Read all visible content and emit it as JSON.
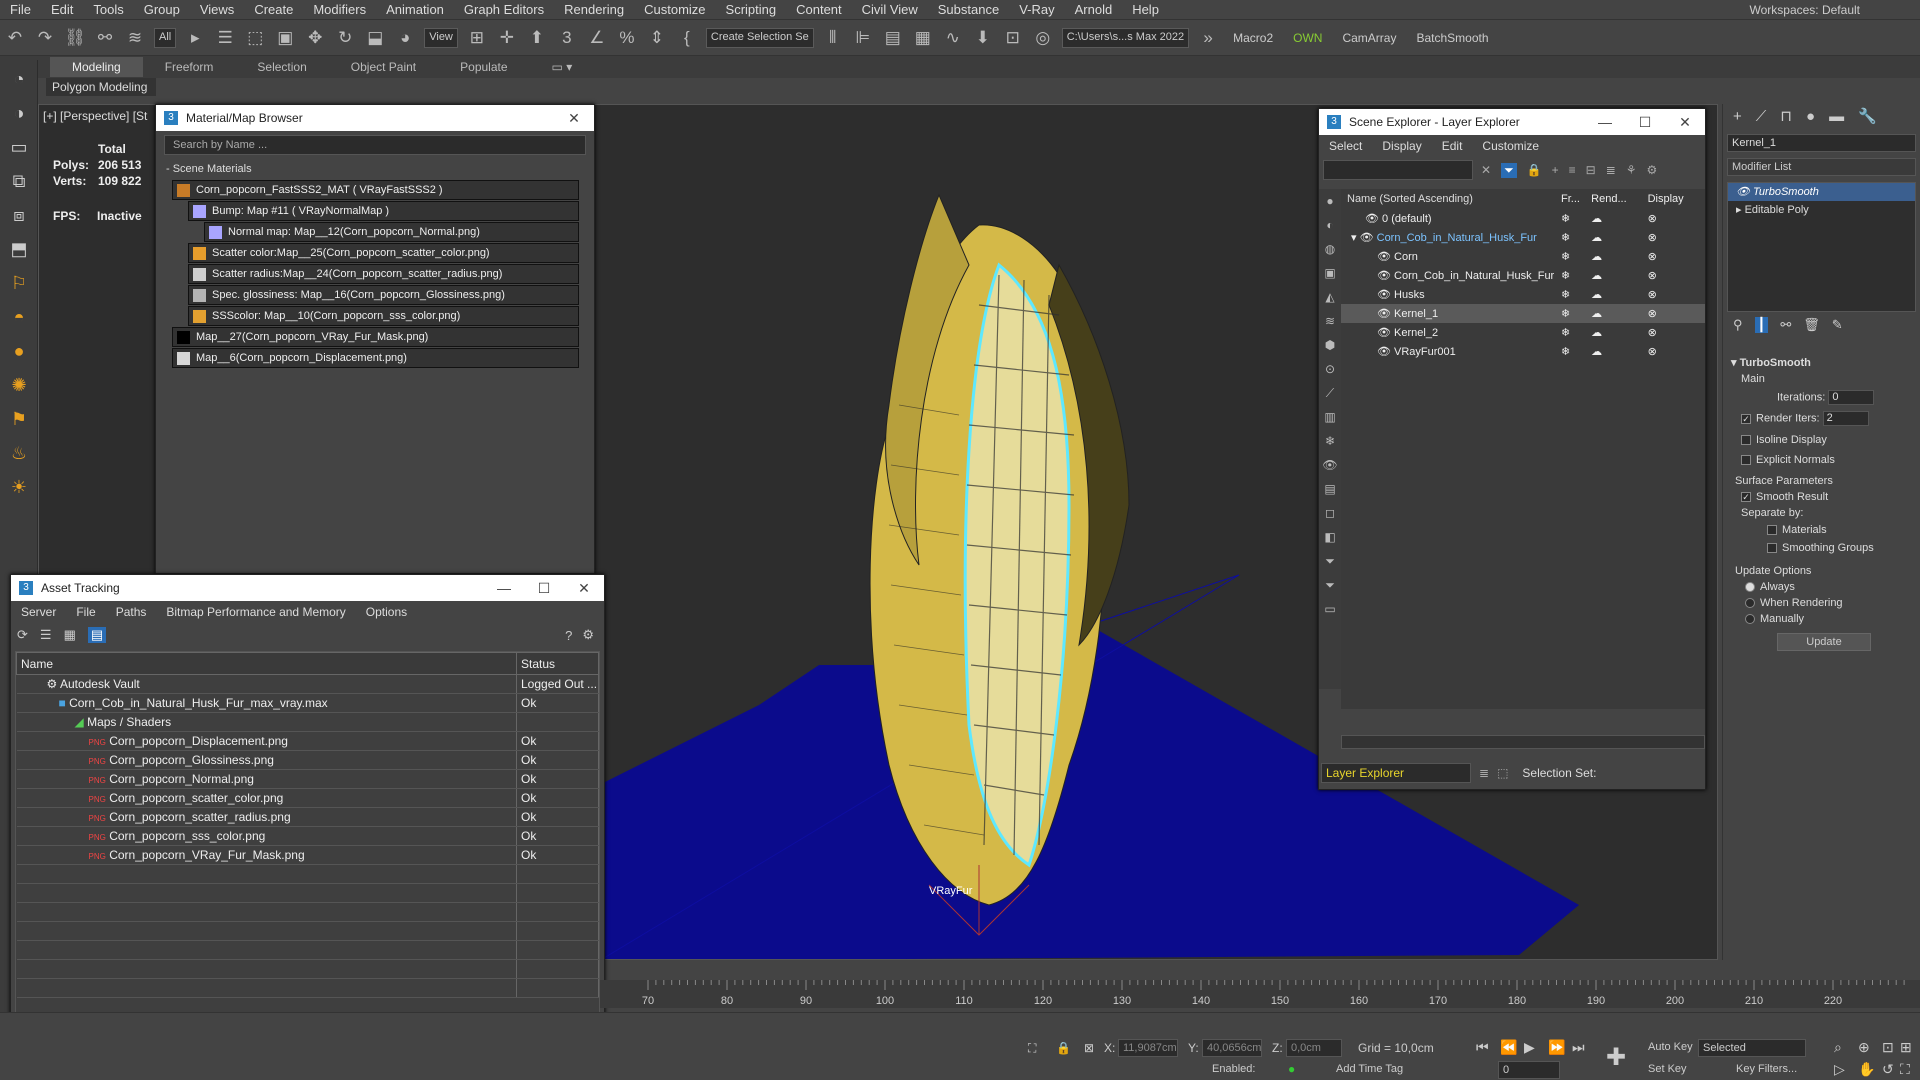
{
  "menubar": {
    "items": [
      "File",
      "Edit",
      "Tools",
      "Group",
      "Views",
      "Create",
      "Modifiers",
      "Animation",
      "Graph Editors",
      "Rendering",
      "Customize",
      "Scripting",
      "Content",
      "Civil View",
      "Substance",
      "V-Ray",
      "Arnold",
      "Help"
    ],
    "workspaces_label": "Workspaces:",
    "workspace": "Default"
  },
  "toolbar": {
    "filter": "All",
    "view": "View",
    "selection_set": "Create Selection Se",
    "path": "C:\\Users\\s...s Max 2022",
    "macro": "Macro2",
    "own": "OWN",
    "camarray": "CamArray",
    "batch": "BatchSmooth"
  },
  "ribbon": {
    "tabs": [
      "Modeling",
      "Freeform",
      "Selection",
      "Object Paint",
      "Populate"
    ],
    "sub": "Polygon Modeling"
  },
  "viewport": {
    "label": "[+] [Perspective] [St",
    "stats": {
      "total": "Total",
      "polys_label": "Polys:",
      "polys": "206 513",
      "verts_label": "Verts:",
      "verts": "109 822"
    },
    "fps_label": "FPS:",
    "fps": "Inactive",
    "object_label": "VRayFur"
  },
  "material_browser": {
    "title": "Material/Map Browser",
    "search": "Search by Name ...",
    "section": "- Scene Materials",
    "items": [
      "Corn_popcorn_FastSSS2_MAT ( VRayFastSSS2 )",
      "Bump: Map #11 ( VRayNormalMap )",
      "Normal map: Map__12(Corn_popcorn_Normal.png)",
      "Scatter color:Map__25(Corn_popcorn_scatter_color.png)",
      "Scatter radius:Map__24(Corn_popcorn_scatter_radius.png)",
      "Spec. glossiness: Map__16(Corn_popcorn_Glossiness.png)",
      "SSScolor: Map__10(Corn_popcorn_sss_color.png)",
      "Map__27(Corn_popcorn_VRay_Fur_Mask.png)",
      "Map__6(Corn_popcorn_Displacement.png)"
    ]
  },
  "asset_tracking": {
    "title": "Asset Tracking",
    "menu": [
      "Server",
      "File",
      "Paths",
      "Bitmap Performance and Memory",
      "Options"
    ],
    "col_name": "Name",
    "col_status": "Status",
    "rows": [
      {
        "name": "Autodesk Vault",
        "status": "Logged Out ..."
      },
      {
        "name": "Corn_Cob_in_Natural_Husk_Fur_max_vray.max",
        "status": "Ok"
      },
      {
        "name": "Maps / Shaders",
        "status": ""
      },
      {
        "name": "Corn_popcorn_Displacement.png",
        "status": "Ok"
      },
      {
        "name": "Corn_popcorn_Glossiness.png",
        "status": "Ok"
      },
      {
        "name": "Corn_popcorn_Normal.png",
        "status": "Ok"
      },
      {
        "name": "Corn_popcorn_scatter_color.png",
        "status": "Ok"
      },
      {
        "name": "Corn_popcorn_scatter_radius.png",
        "status": "Ok"
      },
      {
        "name": "Corn_popcorn_sss_color.png",
        "status": "Ok"
      },
      {
        "name": "Corn_popcorn_VRay_Fur_Mask.png",
        "status": "Ok"
      }
    ]
  },
  "scene_explorer": {
    "title": "Scene Explorer - Layer Explorer",
    "menu": [
      "Select",
      "Display",
      "Edit",
      "Customize"
    ],
    "col_name": "Name (Sorted Ascending)",
    "col_fr": "Fr...",
    "col_rend": "Rend...",
    "col_disp": "Display",
    "rows": [
      "0 (default)",
      "Corn_Cob_in_Natural_Husk_Fur",
      "Corn",
      "Corn_Cob_in_Natural_Husk_Fur",
      "Husks",
      "Kernel_1",
      "Kernel_2",
      "VRayFur001"
    ],
    "footer_mode": "Layer Explorer",
    "selection_set": "Selection Set:"
  },
  "command_panel": {
    "object_name": "Kernel_1",
    "modifier_list": "Modifier List",
    "stack": [
      "TurboSmooth",
      "Editable Poly"
    ],
    "rollout": "TurboSmooth",
    "main": "Main",
    "iterations_label": "Iterations:",
    "iterations": "0",
    "render_iters_label": "Render Iters:",
    "render_iters": "2",
    "isoline": "Isoline Display",
    "explicit": "Explicit Normals",
    "surface": "Surface Parameters",
    "smooth_result": "Smooth Result",
    "separate": "Separate by:",
    "materials": "Materials",
    "smoothing": "Smoothing Groups",
    "update_options": "Update Options",
    "always": "Always",
    "when_rendering": "When Rendering",
    "manually": "Manually",
    "update": "Update"
  },
  "timeline": {
    "ticks": [
      "70",
      "80",
      "90",
      "100",
      "110",
      "120",
      "130",
      "140",
      "150",
      "160",
      "170",
      "180",
      "190",
      "200",
      "210",
      "220"
    ]
  },
  "status": {
    "x_label": "X:",
    "x": "11,9087cm",
    "y_label": "Y:",
    "y": "40,0656cm",
    "z_label": "Z:",
    "z": "0,0cm",
    "grid": "Grid = 10,0cm",
    "auto_key": "Auto Key",
    "selected": "Selected",
    "set_key": "Set Key",
    "key_filters": "Key Filters...",
    "enabled": "Enabled:",
    "add_time_tag": "Add Time Tag",
    "frame": "0"
  }
}
